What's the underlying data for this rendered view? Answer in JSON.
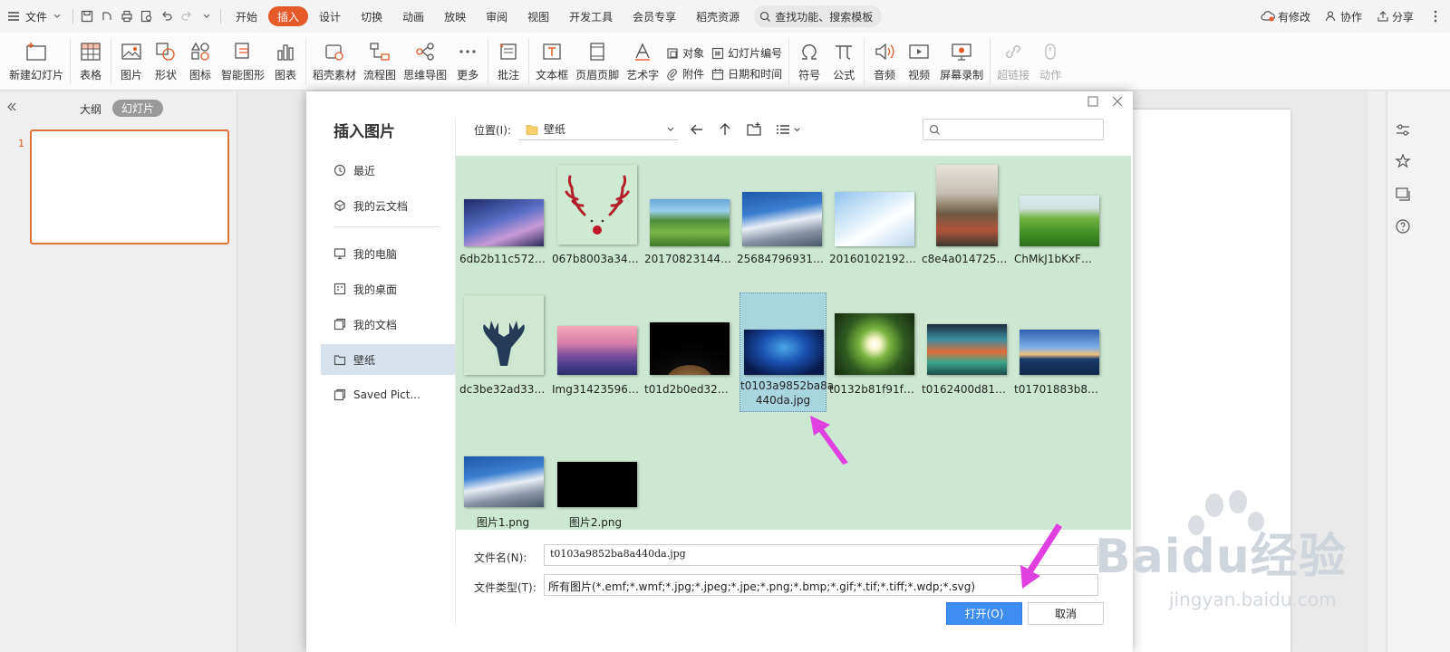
{
  "menubar": {
    "file_label": "文件",
    "tabs": [
      {
        "label": "开始",
        "active": false
      },
      {
        "label": "插入",
        "active": true
      },
      {
        "label": "设计",
        "active": false
      },
      {
        "label": "切换",
        "active": false
      },
      {
        "label": "动画",
        "active": false
      },
      {
        "label": "放映",
        "active": false
      },
      {
        "label": "审阅",
        "active": false
      },
      {
        "label": "视图",
        "active": false
      },
      {
        "label": "开发工具",
        "active": false
      },
      {
        "label": "会员专享",
        "active": false
      },
      {
        "label": "稻壳资源",
        "active": false
      }
    ],
    "search_label": "查找功能、搜索模板",
    "has_changes": "有修改",
    "collab": "协作",
    "share": "分享"
  },
  "ribbon": {
    "new_slide": "新建幻灯片",
    "table": "表格",
    "picture": "图片",
    "shape": "形状",
    "icon": "图标",
    "smart_graphic": "智能图形",
    "chart": "图表",
    "daoke_material": "稻壳素材",
    "flowchart": "流程图",
    "mindmap": "思维导图",
    "more": "更多",
    "comment": "批注",
    "textbox": "文本框",
    "header_footer": "页眉页脚",
    "wordart": "艺术字",
    "object": "对象",
    "slide_number": "幻灯片编号",
    "attachment": "附件",
    "datetime": "日期和时间",
    "symbol": "符号",
    "formula": "公式",
    "audio": "音频",
    "video": "视频",
    "screen_record": "屏幕录制",
    "hyperlink": "超链接",
    "action": "动作"
  },
  "left_panel": {
    "outline_tab": "大纲",
    "slides_tab": "幻灯片",
    "slide_number": "1"
  },
  "dialog": {
    "title": "插入图片",
    "nav": [
      {
        "label": "最近",
        "icon": "clock-icon"
      },
      {
        "label": "我的云文档",
        "icon": "cloud-box-icon"
      },
      {
        "label": "我的电脑",
        "icon": "monitor-icon"
      },
      {
        "label": "我的桌面",
        "icon": "desktop-icon"
      },
      {
        "label": "我的文档",
        "icon": "documents-icon"
      },
      {
        "label": "壁纸",
        "icon": "folder-icon",
        "active": true
      },
      {
        "label": "Saved Pict...",
        "icon": "folder-icon"
      }
    ],
    "location_label": "位置(I):",
    "location_value": "壁纸",
    "files": [
      {
        "name": "6db2b11c5722..."
      },
      {
        "name": "067b8003a346..."
      },
      {
        "name": "2017082314473..."
      },
      {
        "name": "256847969319..."
      },
      {
        "name": "201601021924..."
      },
      {
        "name": "c8e4a01472594..."
      },
      {
        "name": "ChMkJ1bKxFWI..."
      },
      {
        "name": "dc3be32ad337..."
      },
      {
        "name": "Img314235964..."
      },
      {
        "name": "t01d2b0ed325..."
      },
      {
        "name": "t0103a9852ba8a",
        "name2": "440da.jpg",
        "selected": true
      },
      {
        "name": "t0132b81f91f9..."
      },
      {
        "name": "t0162400d81f8..."
      },
      {
        "name": "t01701883b8d..."
      },
      {
        "name": "图片1.png"
      },
      {
        "name": "图片2.png"
      }
    ],
    "filename_label": "文件名(N):",
    "filename_value": "t0103a9852ba8a440da.jpg",
    "filetype_label": "文件类型(T):",
    "filetype_value": "所有图片(*.emf;*.wmf;*.jpg;*.jpeg;*.jpe;*.png;*.bmp;*.gif;*.tif;*.tiff;*.wdp;*.svg)",
    "open_button": "打开(O)",
    "cancel_button": "取消"
  },
  "watermark": {
    "brand": "Baidu经验",
    "url": "jingyan.baidu.com"
  },
  "colors": {
    "accent": "#e65a2a",
    "grid_bg": "#cde8d2",
    "selected_tile": "#a8d6df",
    "open_button": "#3d8ef0",
    "annotation_arrow": "#e040e0"
  }
}
